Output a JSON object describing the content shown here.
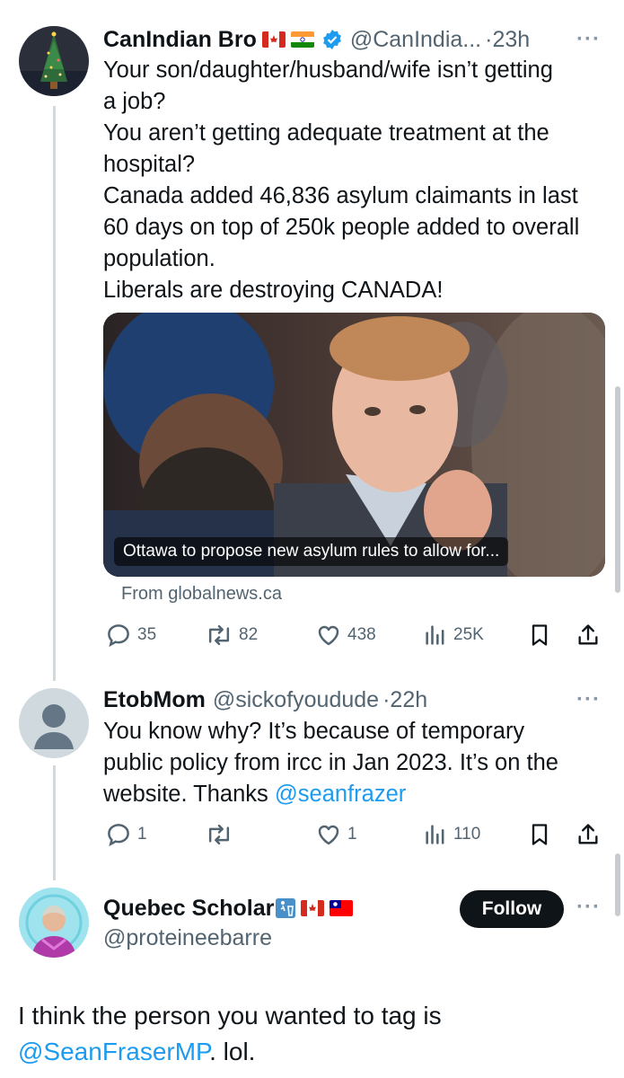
{
  "tweet1": {
    "name": "CanIndian Bro",
    "handle": "@CanIndia...",
    "dot": "·",
    "time": "23h",
    "more": "···",
    "text_lines": [
      "Your son/daughter/husband/wife isn’t getting",
      "a job?",
      "You aren’t getting adequate treatment at the",
      "hospital?",
      "Canada added 46,836 asylum claimants in last",
      "60 days on top of 250k people added to overall",
      "population.",
      "Liberals are destroying CANADA!"
    ],
    "card": {
      "caption": "Ottawa to propose new asylum rules to allow for...",
      "source": "From globalnews.ca"
    },
    "stats": {
      "replies": "35",
      "reposts": "82",
      "likes": "438",
      "views": "25K"
    }
  },
  "tweet2": {
    "name": "EtobMom",
    "handle": "@sickofyoudude",
    "dot": "·",
    "time": "22h",
    "more": "···",
    "text_lines": [
      "You know why? It’s because of temporary",
      "public policy from ircc in Jan 2023. It’s on the"
    ],
    "text_last_prefix": "website. Thanks ",
    "text_last_mention": "@seanfrazer",
    "stats": {
      "replies": "1",
      "reposts": "",
      "likes": "1",
      "views": "110"
    }
  },
  "tweet3": {
    "name": "Quebec Scholar",
    "handle": "@proteineebarre",
    "follow_label": "Follow",
    "more": "···",
    "text_line1": "I think the person you wanted to tag is",
    "text_mention": "@SeanFraserMP",
    "text_suffix": ". lol."
  },
  "colors": {
    "accent": "#1d9bf0",
    "text": "#0f1419",
    "secondary": "#536471",
    "thread_line": "#cfd9de"
  },
  "icons": [
    "reply-icon",
    "repost-icon",
    "like-icon",
    "views-icon",
    "bookmark-icon",
    "share-icon",
    "verified-icon",
    "canada-flag-icon",
    "india-flag-icon",
    "taiwan-flag-icon",
    "trash-sign-icon"
  ]
}
